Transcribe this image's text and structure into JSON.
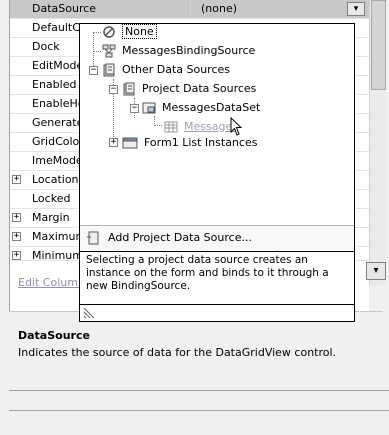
{
  "grid": {
    "rows": [
      {
        "name": "DataSource",
        "value": "(none)",
        "selected": true,
        "expander": ""
      },
      {
        "name": "DefaultCellStyle",
        "expander": ""
      },
      {
        "name": "Dock",
        "expander": ""
      },
      {
        "name": "EditMode",
        "expander": ""
      },
      {
        "name": "Enabled",
        "expander": ""
      },
      {
        "name": "EnableHeadersVisualStyles",
        "expander": ""
      },
      {
        "name": "GenerateMember",
        "expander": ""
      },
      {
        "name": "GridColor",
        "expander": ""
      },
      {
        "name": "ImeMode",
        "expander": ""
      },
      {
        "name": "Location",
        "expander": "+"
      },
      {
        "name": "Locked",
        "expander": ""
      },
      {
        "name": "Margin",
        "expander": "+"
      },
      {
        "name": "MaximumSize",
        "expander": "+"
      },
      {
        "name": "MinimumSize",
        "expander": "+"
      }
    ],
    "dropdown_arrow": "▾",
    "scroll_down_arrow": "▾",
    "edit_columns_link": "Edit Columns..."
  },
  "popup": {
    "tree": {
      "none_label": "None",
      "binding_source_label": "MessagesBindingSource",
      "other_sources_label": "Other Data Sources",
      "project_sources_label": "Project Data Sources",
      "dataset_label": "MessagesDataSet",
      "table_label": "Messages",
      "form_label": "Form1 List Instances"
    },
    "expanders": {
      "other_sources": "−",
      "project_sources": "−",
      "dataset": "−",
      "form": "+"
    },
    "add_label": "Add Project Data Source...",
    "description": "Selecting a project data source creates an instance on the form and binds to it through a new BindingSource."
  },
  "description_panel": {
    "title": "DataSource",
    "text": "Indicates the source of data for the DataGridView control."
  },
  "colors": {
    "selected_row": "#c8c8c8",
    "link_disabled": "#9090b0",
    "messages_link": "#9aa0b0"
  }
}
